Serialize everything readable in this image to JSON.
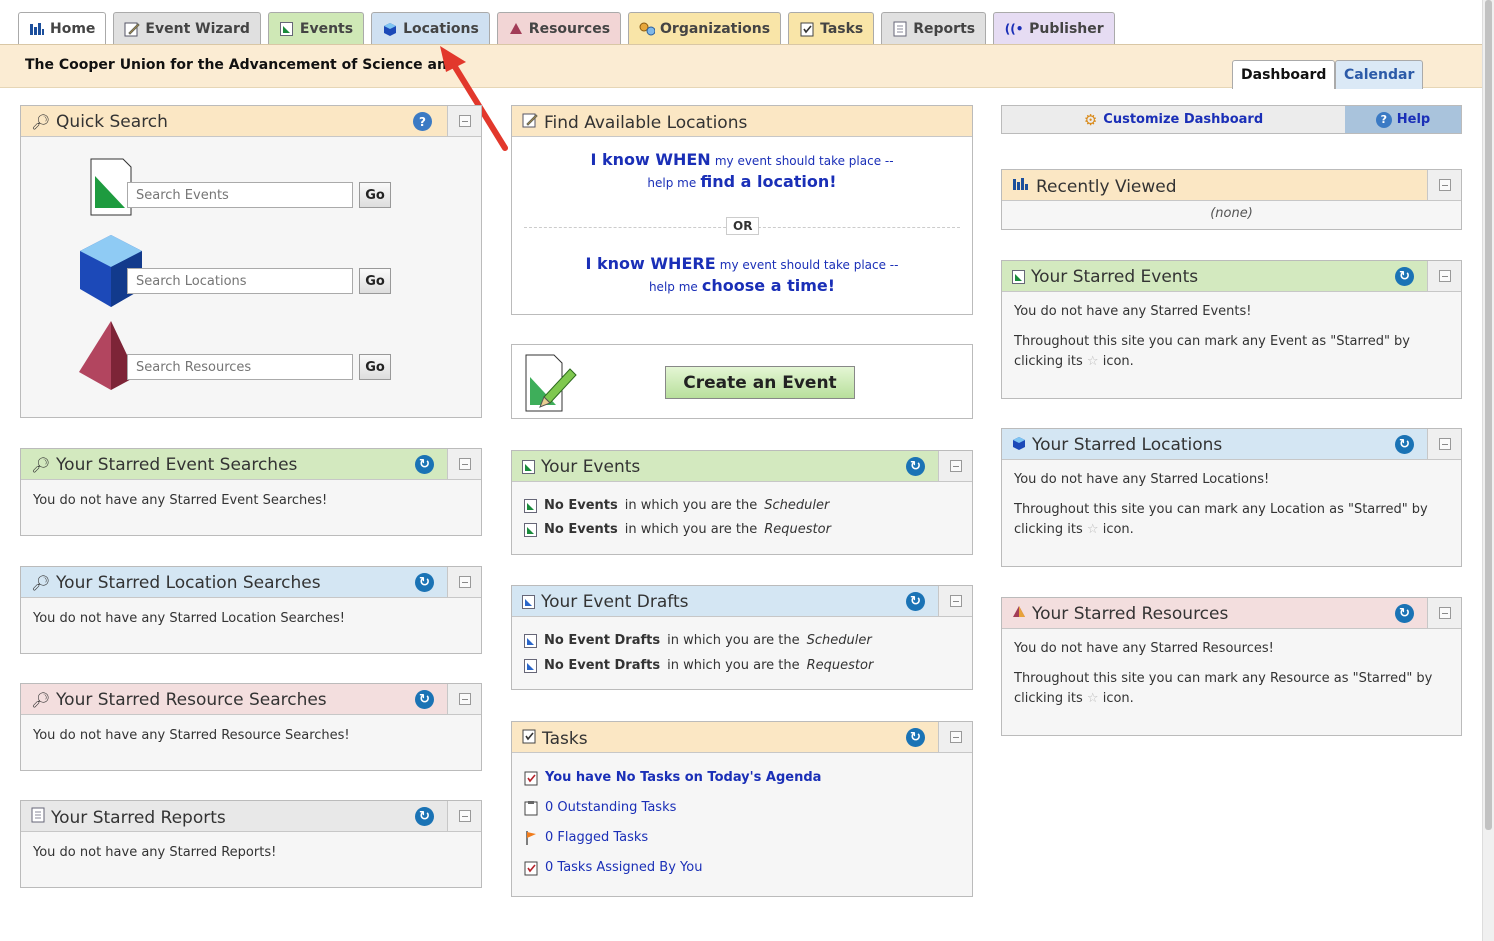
{
  "nav": {
    "tabs": [
      {
        "label": "Home",
        "color": "#ffffff",
        "icon": "home-icon"
      },
      {
        "label": "Event Wizard",
        "color": "#e0e0e0",
        "icon": "pencil-icon"
      },
      {
        "label": "Events",
        "color": "#cfe8b6",
        "icon": "event-doc-icon"
      },
      {
        "label": "Locations",
        "color": "#cfe0f1",
        "icon": "location-cube-icon"
      },
      {
        "label": "Resources",
        "color": "#f2d5d5",
        "icon": "resource-pyramid-icon"
      },
      {
        "label": "Organizations",
        "color": "#f9e5a8",
        "icon": "organizations-icon"
      },
      {
        "label": "Tasks",
        "color": "#f9e5a8",
        "icon": "task-check-icon"
      },
      {
        "label": "Reports",
        "color": "#e0e0e0",
        "icon": "report-icon"
      },
      {
        "label": "Publisher",
        "color": "#e6dcf3",
        "icon": "publisher-icon"
      }
    ]
  },
  "org": {
    "name": "The Cooper Union for the Advancement of Science and Art"
  },
  "view_tabs": {
    "dashboard": "Dashboard",
    "calendar": "Calendar"
  },
  "quick_search": {
    "title": "Quick Search",
    "events_placeholder": "Search Events",
    "locations_placeholder": "Search Locations",
    "resources_placeholder": "Search Resources",
    "go": "Go"
  },
  "starred_event_searches": {
    "title": "Your Starred Event Searches",
    "message": "You do not have any Starred Event Searches!"
  },
  "starred_location_searches": {
    "title": "Your Starred Location Searches",
    "message": "You do not have any Starred Location Searches!"
  },
  "starred_resource_searches": {
    "title": "Your Starred Resource Searches",
    "message": "You do not have any Starred Resource Searches!"
  },
  "starred_reports": {
    "title": "Your Starred Reports",
    "message": "You do not have any Starred Reports!"
  },
  "find_locations": {
    "title": "Find Available Locations",
    "when_big": "I know WHEN",
    "when_small": "my event should take place --",
    "help_me_1": "help me",
    "find_location": "find a location!",
    "or": "OR",
    "where_big": "I know WHERE",
    "where_small": "my event should take place --",
    "help_me_2": "help me",
    "choose_time": "choose a time!"
  },
  "create_event": {
    "label": "Create an Event"
  },
  "your_events": {
    "title": "Your Events",
    "line1_bold": "No Events",
    "line1_text": "in which you are the",
    "line1_role": "Scheduler",
    "line2_bold": "No Events",
    "line2_text": "in which you are the",
    "line2_role": "Requestor"
  },
  "event_drafts": {
    "title": "Your Event Drafts",
    "line1_bold": "No Event Drafts",
    "line1_text": "in which you are the",
    "line1_role": "Scheduler",
    "line2_bold": "No Event Drafts",
    "line2_text": "in which you are the",
    "line2_role": "Requestor"
  },
  "tasks": {
    "title": "Tasks",
    "agenda": "You have No Tasks on Today's Agenda",
    "outstanding": "0 Outstanding Tasks",
    "flagged": "0 Flagged Tasks",
    "assigned": "0 Tasks Assigned By You"
  },
  "dashboard_bar": {
    "customize": "Customize Dashboard",
    "help": "Help"
  },
  "recently_viewed": {
    "title": "Recently Viewed",
    "none": "(none)"
  },
  "starred_events": {
    "title": "Your Starred Events",
    "message": "You do not have any Starred Events!",
    "hint_a": "Throughout this site you can mark any Event as \"Starred\" by",
    "hint_b": "clicking its",
    "hint_c": "icon."
  },
  "starred_locations": {
    "title": "Your Starred Locations",
    "message": "You do not have any Starred Locations!",
    "hint_a": "Throughout this site you can mark any Location as \"Starred\" by",
    "hint_b": "clicking its",
    "hint_c": "icon."
  },
  "starred_resources": {
    "title": "Your Starred Resources",
    "message": "You do not have any Starred Resources!",
    "hint_a": "Throughout this site you can mark any Resource as \"Starred\" by",
    "hint_b": "clicking its",
    "hint_c": "icon."
  },
  "colors": {
    "accent_blue": "#1a2fb7",
    "annotation_arrow": "#e2382c",
    "refresh": "#1a73b5"
  }
}
